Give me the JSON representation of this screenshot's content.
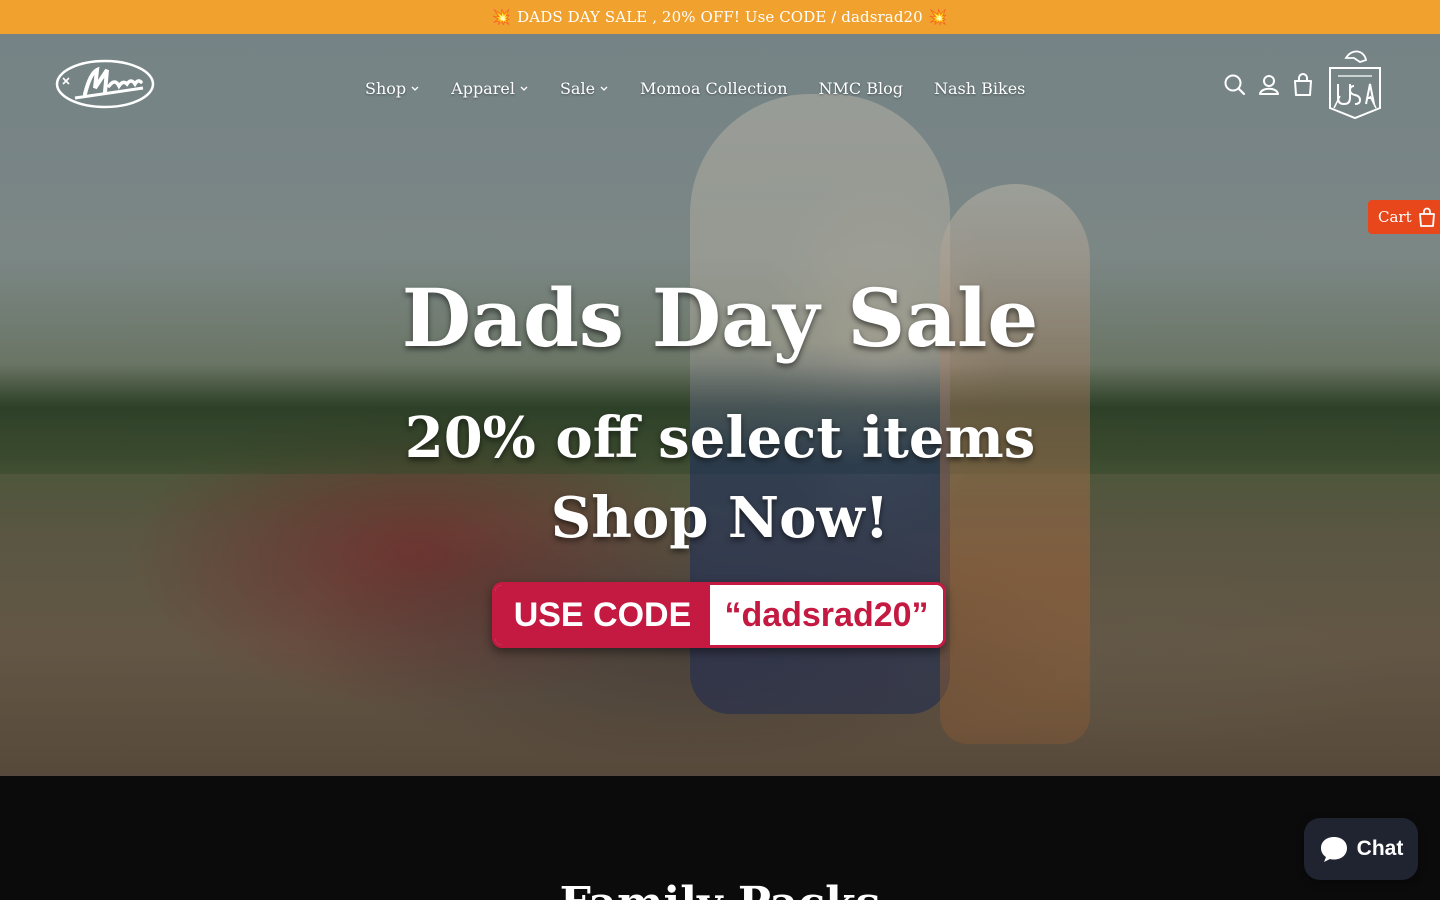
{
  "announcement": {
    "text": "DADS DAY SALE , 20% OFF! Use CODE / dadsrad20",
    "emoji_left": "💥",
    "emoji_right": "💥"
  },
  "header": {
    "logo_icon": "nash-motorcycle-logo",
    "nav": [
      {
        "label": "Shop",
        "has_dropdown": true
      },
      {
        "label": "Apparel",
        "has_dropdown": true
      },
      {
        "label": "Sale",
        "has_dropdown": true
      },
      {
        "label": "Momoa Collection",
        "has_dropdown": false
      },
      {
        "label": "NMC Blog",
        "has_dropdown": false
      },
      {
        "label": "Nash Bikes",
        "has_dropdown": false
      }
    ],
    "icons": [
      "search-icon",
      "account-icon",
      "cart-bag-icon"
    ],
    "badge_icon": "made-in-usa-badge"
  },
  "cart_tab": {
    "label": "Cart"
  },
  "hero": {
    "title": "Dads Day Sale",
    "subtitle_line1": "20% off select items",
    "subtitle_line2": "Shop Now!",
    "code_label": "USE CODE",
    "code_value": "“dadsrad20”"
  },
  "next_section": {
    "heading": "Family Packs"
  },
  "chat": {
    "label": "Chat"
  },
  "colors": {
    "announcement_bg": "#f0a12e",
    "cart_tab_bg": "#e8471c",
    "code_badge": "#c41a42",
    "chat_bg": "#1f2430",
    "dark_section_bg": "#0b0b0c"
  }
}
